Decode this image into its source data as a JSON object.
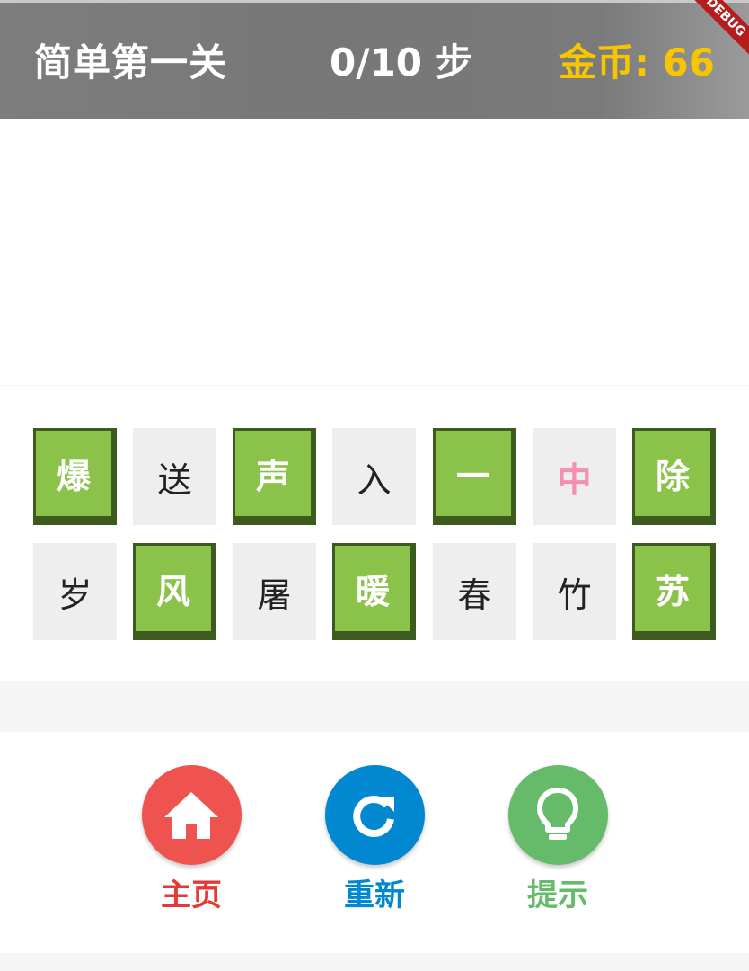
{
  "header": {
    "level_title": "简单第一关",
    "steps_text": "0/10 步",
    "coins_text": "金币: 66",
    "debug_banner": "DEBUG"
  },
  "board": {
    "rows": [
      [
        {
          "char": "爆",
          "selected": true
        },
        {
          "char": "送",
          "selected": false
        },
        {
          "char": "声",
          "selected": true
        },
        {
          "char": "入",
          "selected": false
        },
        {
          "char": "一",
          "selected": true
        },
        {
          "char": "中",
          "selected": false,
          "highlight": "pink"
        },
        {
          "char": "除",
          "selected": true
        }
      ],
      [
        {
          "char": "岁",
          "selected": false
        },
        {
          "char": "风",
          "selected": true
        },
        {
          "char": "屠",
          "selected": false
        },
        {
          "char": "暖",
          "selected": true
        },
        {
          "char": "春",
          "selected": false
        },
        {
          "char": "竹",
          "selected": false
        },
        {
          "char": "苏",
          "selected": true
        }
      ]
    ]
  },
  "actions": {
    "home": {
      "label": "主页",
      "icon": "home-icon",
      "color": "#ef5350"
    },
    "restart": {
      "label": "重新",
      "icon": "refresh-icon",
      "color": "#0288d1"
    },
    "hint": {
      "label": "提示",
      "icon": "lightbulb-icon",
      "color": "#66bb6a"
    }
  },
  "colors": {
    "header_bg": "#7a7a7a",
    "coins": "#f7c600",
    "tile_selected": "#8bc34a",
    "tile_selected_border": "#3d5a1f",
    "tile_plain": "#eeeeee",
    "pink_char": "#f48fb1"
  }
}
